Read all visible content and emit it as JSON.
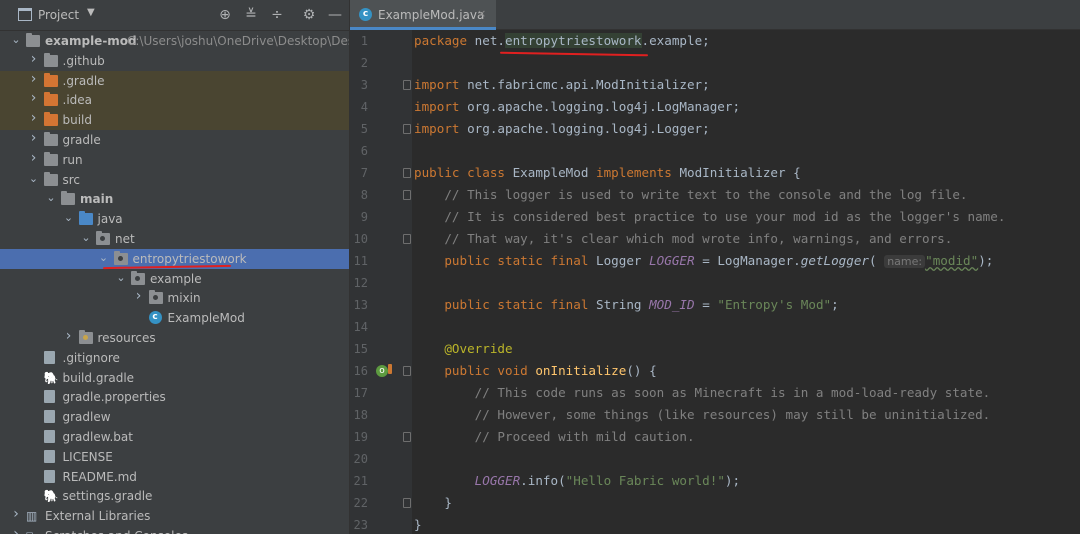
{
  "project_panel": {
    "title": "Project",
    "tree": [
      {
        "label": "example-mod",
        "path": "C:\\Users\\joshu\\OneDrive\\Desktop\\Desktop",
        "bold": true,
        "arrow": "open",
        "icon": "module-folder-icon",
        "depth": 0
      },
      {
        "label": ".github",
        "arrow": "closed",
        "icon": "folder-icon",
        "depth": 1
      },
      {
        "label": ".gradle",
        "arrow": "closed",
        "icon": "excluded-folder-icon",
        "depth": 1,
        "highlight": true
      },
      {
        "label": ".idea",
        "arrow": "closed",
        "icon": "excluded-folder-icon",
        "depth": 1,
        "highlight": true
      },
      {
        "label": "build",
        "arrow": "closed",
        "icon": "excluded-folder-icon",
        "depth": 1,
        "highlight": true
      },
      {
        "label": "gradle",
        "arrow": "closed",
        "icon": "folder-icon",
        "depth": 1
      },
      {
        "label": "run",
        "arrow": "closed",
        "icon": "folder-icon",
        "depth": 1
      },
      {
        "label": "src",
        "arrow": "open",
        "icon": "folder-icon",
        "depth": 1
      },
      {
        "label": "main",
        "arrow": "open",
        "icon": "folder-icon",
        "depth": 2,
        "bold": true
      },
      {
        "label": "java",
        "arrow": "open",
        "icon": "source-folder-icon",
        "depth": 3
      },
      {
        "label": "net",
        "arrow": "open",
        "icon": "package-icon",
        "depth": 4
      },
      {
        "label": "entropytriestowork",
        "arrow": "open",
        "icon": "package-icon",
        "depth": 5,
        "selected": true
      },
      {
        "label": "example",
        "arrow": "open",
        "icon": "package-icon",
        "depth": 6
      },
      {
        "label": "mixin",
        "arrow": "closed",
        "icon": "package-icon",
        "depth": 7
      },
      {
        "label": "ExampleMod",
        "arrow": "none",
        "icon": "java-class-icon",
        "depth": 7
      },
      {
        "label": "resources",
        "arrow": "closed",
        "icon": "resources-folder-icon",
        "depth": 3
      },
      {
        "label": ".gitignore",
        "arrow": "none",
        "icon": "gitignore-file-icon",
        "depth": 1
      },
      {
        "label": "build.gradle",
        "arrow": "none",
        "icon": "gradle-file-icon",
        "depth": 1
      },
      {
        "label": "gradle.properties",
        "arrow": "none",
        "icon": "properties-file-icon",
        "depth": 1
      },
      {
        "label": "gradlew",
        "arrow": "none",
        "icon": "script-file-icon",
        "depth": 1
      },
      {
        "label": "gradlew.bat",
        "arrow": "none",
        "icon": "text-file-icon",
        "depth": 1
      },
      {
        "label": "LICENSE",
        "arrow": "none",
        "icon": "text-file-icon",
        "depth": 1
      },
      {
        "label": "README.md",
        "arrow": "none",
        "icon": "markdown-file-icon",
        "depth": 1
      },
      {
        "label": "settings.gradle",
        "arrow": "none",
        "icon": "gradle-file-icon",
        "depth": 1
      },
      {
        "label": "External Libraries",
        "arrow": "closed",
        "icon": "library-icon",
        "depth": 0
      },
      {
        "label": "Scratches and Consoles",
        "arrow": "closed",
        "icon": "scratch-icon",
        "depth": 0
      }
    ]
  },
  "editor": {
    "tab": {
      "label": "ExampleMod.java",
      "close": "×"
    },
    "line_numbers": [
      "1",
      "2",
      "3",
      "4",
      "5",
      "6",
      "7",
      "8",
      "9",
      "10",
      "11",
      "12",
      "13",
      "14",
      "15",
      "16",
      "17",
      "18",
      "19",
      "20",
      "21",
      "22",
      "23"
    ],
    "code": {
      "l1": {
        "kw": "package",
        "pre": "net.",
        "pkg": "entropytriestowork",
        "post": ".example;"
      },
      "l3": {
        "kw": "import",
        "rest": "net.fabricmc.api.ModInitializer;"
      },
      "l4": {
        "kw": "import",
        "rest": "org.apache.logging.log4j.LogManager;"
      },
      "l5": {
        "kw": "import",
        "rest": "org.apache.logging.log4j.Logger;"
      },
      "l7": {
        "kw1": "public class",
        "name": "ExampleMod",
        "kw2": "implements",
        "iface": "ModInitializer {"
      },
      "l8": "// This logger is used to write text to the console and the log file.",
      "l9": "// It is considered best practice to use your mod id as the logger's name.",
      "l10": "// That way, it's clear which mod wrote info, warnings, and errors.",
      "l11": {
        "kw": "public static final",
        "type": "Logger",
        "field": "LOGGER",
        "eq": "= LogManager.",
        "method": "getLogger",
        "open": "(",
        "hint": "name:",
        "str": "\"modid\"",
        "close": ");"
      },
      "l13": {
        "kw": "public static final",
        "type": "String",
        "field": "MOD_ID",
        "eq": "=",
        "str": "\"Entropy's Mod\"",
        "close": ";"
      },
      "l15": "@Override",
      "l16": {
        "kw": "public void",
        "method": "onInitialize",
        "rest": "() {"
      },
      "l17": "// This code runs as soon as Minecraft is in a mod-load-ready state.",
      "l18": "// However, some things (like resources) may still be uninitialized.",
      "l19": "// Proceed with mild caution.",
      "l21": {
        "field": "LOGGER",
        "call": ".info(",
        "str": "\"Hello Fabric world!\"",
        "close": ");"
      },
      "l22": "}",
      "l23": "}"
    }
  },
  "colors": {
    "annotation_underline": "#e02020",
    "selection": "#4b6eaf",
    "excluded_highlight": "#4a4531"
  }
}
